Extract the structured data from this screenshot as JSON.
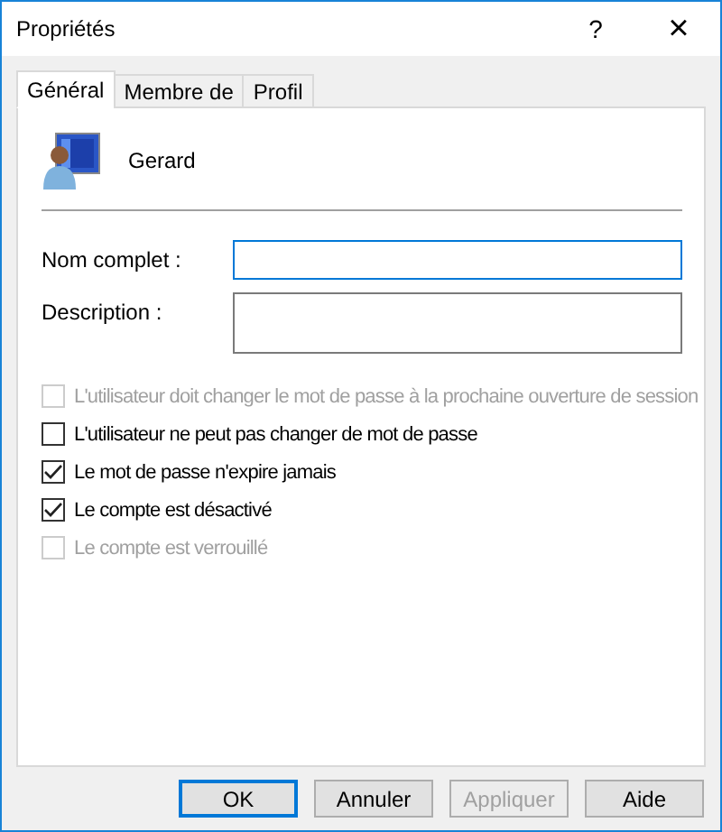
{
  "window": {
    "title": "Propriétés",
    "help": "?",
    "close": "×"
  },
  "tabs": [
    {
      "label": "Général",
      "selected": true
    },
    {
      "label": "Membre de",
      "selected": false
    },
    {
      "label": "Profil",
      "selected": false
    }
  ],
  "user": {
    "name": "Gerard"
  },
  "fields": [
    {
      "label": "Nom complet :",
      "focused": true,
      "kind": "line"
    },
    {
      "label": "Description :",
      "focused": false,
      "kind": "tall"
    }
  ],
  "options": [
    {
      "label": "L'utilisateur doit changer le mot de passe à la prochaine ouverture de session",
      "checked": false,
      "disabled": true
    },
    {
      "label": "L'utilisateur ne peut pas changer de mot de passe",
      "checked": false,
      "disabled": false
    },
    {
      "label": "Le mot de passe n'expire jamais",
      "checked": true,
      "disabled": false
    },
    {
      "label": "Le compte est désactivé",
      "checked": true,
      "disabled": false
    },
    {
      "label": "Le compte est verrouillé",
      "checked": false,
      "disabled": true
    }
  ],
  "buttons": [
    {
      "label": "OK",
      "default": true,
      "disabled": false
    },
    {
      "label": "Annuler",
      "default": false,
      "disabled": false
    },
    {
      "label": "Appliquer",
      "default": false,
      "disabled": true
    },
    {
      "label": "Aide",
      "default": false,
      "disabled": false
    }
  ]
}
